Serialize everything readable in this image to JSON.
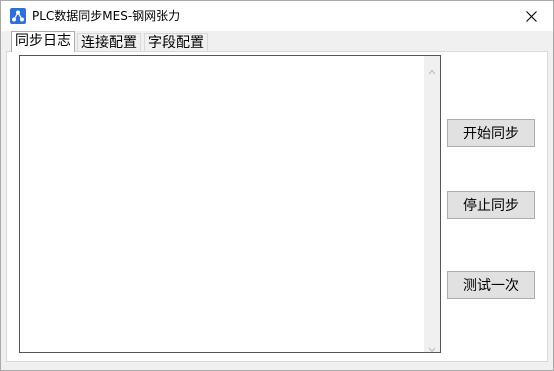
{
  "window": {
    "title": "PLC数据同步MES-钢网张力",
    "app_icon": "network-nodes-icon",
    "close_icon": "close-icon"
  },
  "tabs": [
    {
      "label": "同步日志",
      "selected": true
    },
    {
      "label": "连接配置",
      "selected": false
    },
    {
      "label": "字段配置",
      "selected": false
    }
  ],
  "log": {
    "content": ""
  },
  "buttons": {
    "start_sync": "开始同步",
    "stop_sync": "停止同步",
    "test_once": "测试一次"
  },
  "colors": {
    "accent_icon": "#2e6fd8",
    "window_bg": "#f0f0f0",
    "button_bg": "#e1e1e1"
  }
}
